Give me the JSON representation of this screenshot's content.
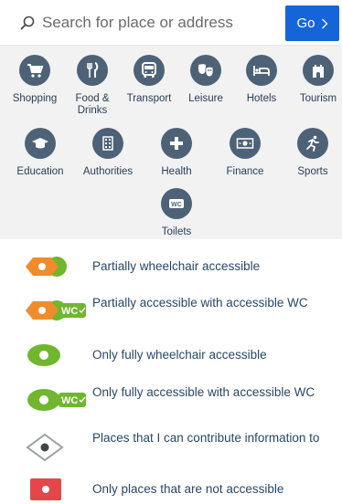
{
  "search": {
    "placeholder": "Search for place or address",
    "go_label": "Go"
  },
  "categories": [
    {
      "label": "Shopping",
      "icon": "shopping-cart-icon"
    },
    {
      "label": "Food & Drinks",
      "icon": "fork-knife-icon"
    },
    {
      "label": "Transport",
      "icon": "bus-icon"
    },
    {
      "label": "Leisure",
      "icon": "theater-masks-icon"
    },
    {
      "label": "Hotels",
      "icon": "bed-icon"
    },
    {
      "label": "Tourism",
      "icon": "castle-icon"
    },
    {
      "label": "Education",
      "icon": "graduation-cap-icon"
    },
    {
      "label": "Authorities",
      "icon": "building-icon"
    },
    {
      "label": "Health",
      "icon": "plus-cross-icon"
    },
    {
      "label": "Finance",
      "icon": "banknote-icon"
    },
    {
      "label": "Sports",
      "icon": "runner-icon"
    },
    {
      "label": "Toilets",
      "icon": "wc-icon"
    }
  ],
  "legend": [
    {
      "label": "Partially wheelchair accessible",
      "marker": "orange-green-tag"
    },
    {
      "label": "Partially accessible with accessible WC",
      "marker": "orange-green-tag-wc",
      "badge": "WC"
    },
    {
      "label": "Only fully wheelchair accessible",
      "marker": "green-circle"
    },
    {
      "label": "Only fully accessible with accessible WC",
      "marker": "green-circle-wc",
      "badge": "WC"
    },
    {
      "label": "Places that I can contribute information to",
      "marker": "grey-diamond"
    },
    {
      "label": "Only places that are not accessible",
      "marker": "red-square"
    }
  ],
  "colors": {
    "accent": "#1565d8",
    "category_icon": "#4e6277",
    "orange": "#f08c2b",
    "green": "#70b62f",
    "red": "#e5464a",
    "grey": "#9aa0a6"
  }
}
